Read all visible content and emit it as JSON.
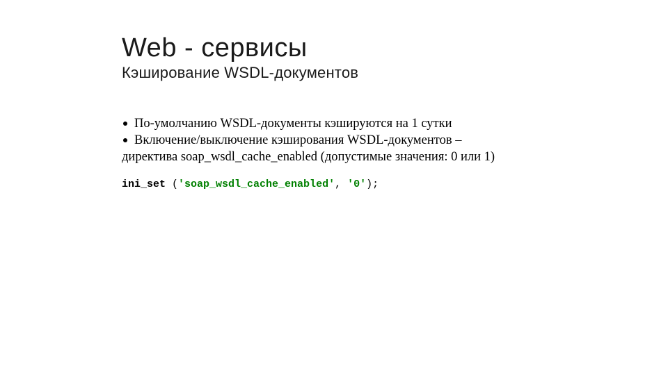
{
  "title": "Web - сервисы",
  "subtitle": "Кэширование WSDL-документов",
  "bullets": {
    "b1": "По-умолчанию WSDL-документы кэшируются на 1 сутки",
    "b2": "Включение/выключение кэширования WSDL-документов –",
    "b2cont": "директива soap_wsdl_cache_enabled (допустимые значения: 0 или 1)"
  },
  "code": {
    "fn": "ini_set",
    "open": " (",
    "arg1": "'soap_wsdl_cache_enabled'",
    "comma": ", ",
    "arg2": "'0'",
    "close": ");"
  }
}
